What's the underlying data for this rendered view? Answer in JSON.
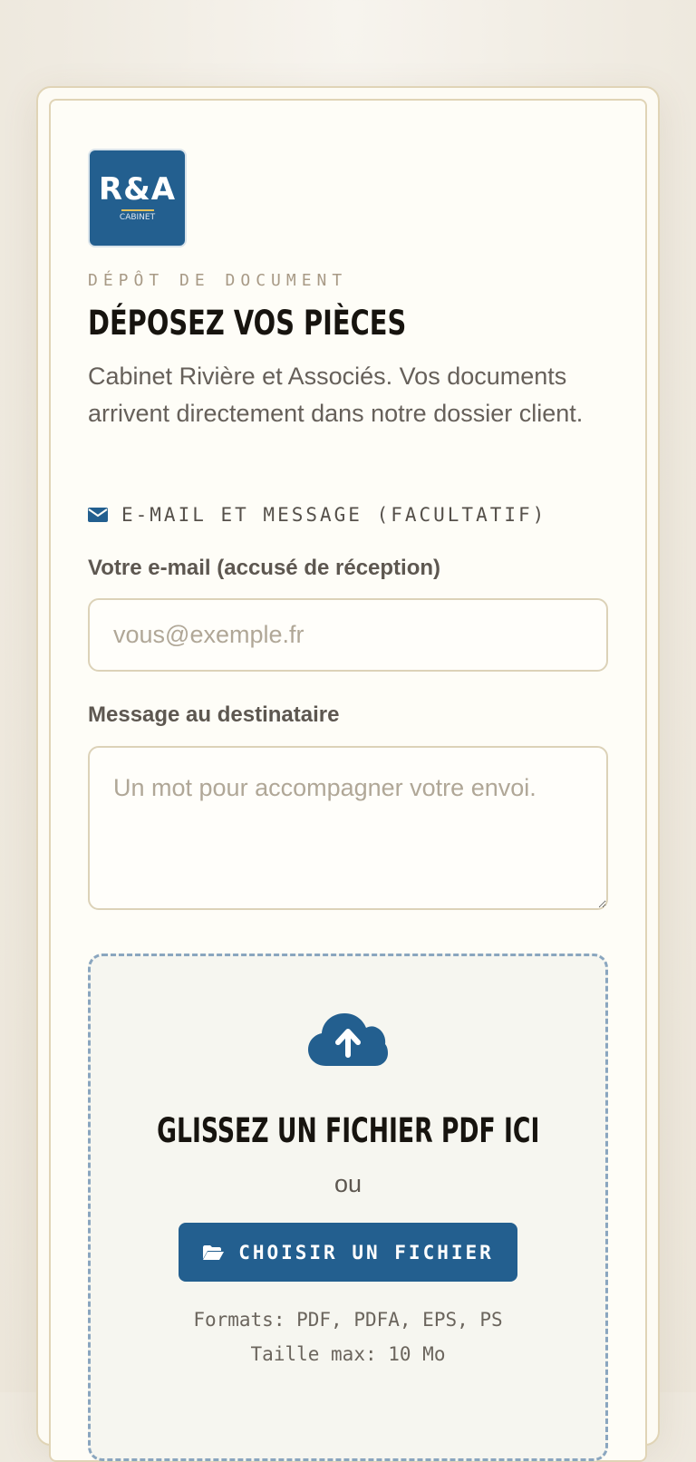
{
  "logo": {
    "text": "R&A",
    "subtext": "CABINET",
    "color": "#235f8f"
  },
  "header": {
    "eyebrow": "DÉPÔT DE DOCUMENT",
    "title": "DÉPOSEZ VOS PIÈCES",
    "intro": "Cabinet Rivière et Associés. Vos documents arrivent directement dans notre dossier client."
  },
  "section": {
    "icon": "envelope-icon",
    "label": "E-MAIL ET MESSAGE (FACULTATIF)"
  },
  "email": {
    "label": "Votre e-mail (accusé de réception)",
    "placeholder": "vous@exemple.fr",
    "value": ""
  },
  "message": {
    "label": "Message au destinataire",
    "placeholder": "Un mot pour accompagner votre envoi.",
    "value": ""
  },
  "dropzone": {
    "icon": "cloud-upload-icon",
    "title": "GLISSEZ UN FICHIER PDF ICI",
    "or": "ou",
    "button_icon": "folder-open-icon",
    "button_label": "CHOISIR UN FICHIER",
    "formats": "Formats: PDF, PDFA, EPS, PS",
    "max_size": "Taille max: 10 Mo"
  },
  "colors": {
    "accent": "#235f8f",
    "border": "#dcd2b8",
    "background": "#fefdf7"
  }
}
